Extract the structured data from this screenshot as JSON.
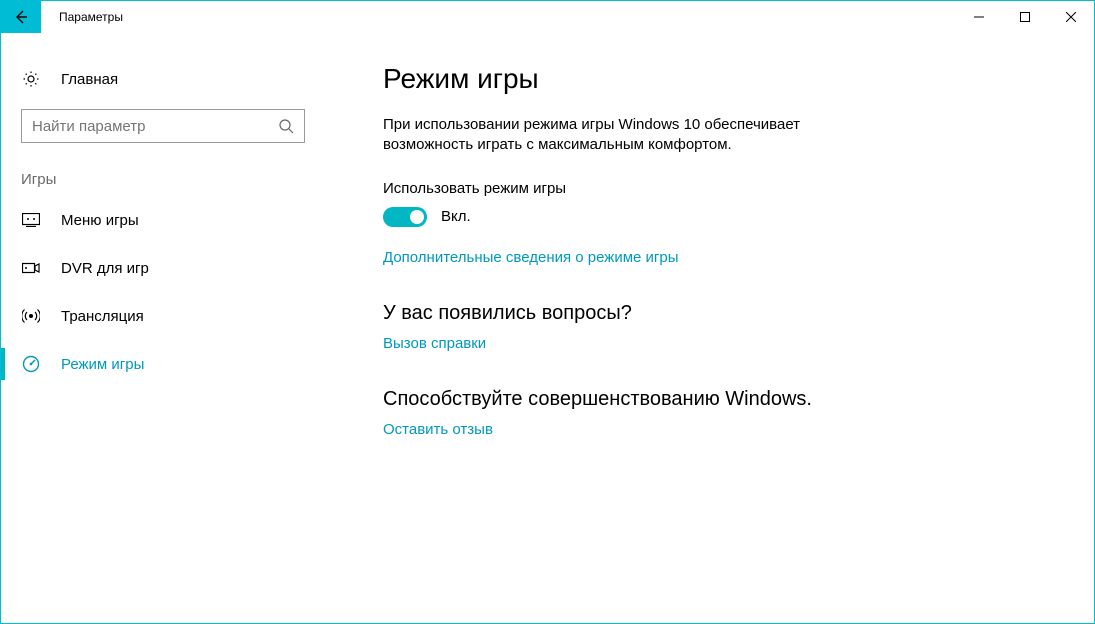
{
  "window": {
    "title": "Параметры"
  },
  "sidebar": {
    "home_label": "Главная",
    "search_placeholder": "Найти параметр",
    "category_label": "Игры",
    "items": [
      {
        "label": "Меню игры"
      },
      {
        "label": "DVR для игр"
      },
      {
        "label": "Трансляция"
      },
      {
        "label": "Режим игры"
      }
    ]
  },
  "main": {
    "heading": "Режим игры",
    "description": "При использовании режима игры Windows 10 обеспечивает возможность играть с максимальным комфортом.",
    "toggle": {
      "label": "Использовать режим игры",
      "status": "Вкл."
    },
    "more_info_link": "Дополнительные сведения о режиме игры",
    "questions": {
      "heading": "У вас появились вопросы?",
      "link": "Вызов справки"
    },
    "feedback": {
      "heading": "Способствуйте совершенствованию Windows.",
      "link": "Оставить отзыв"
    }
  }
}
